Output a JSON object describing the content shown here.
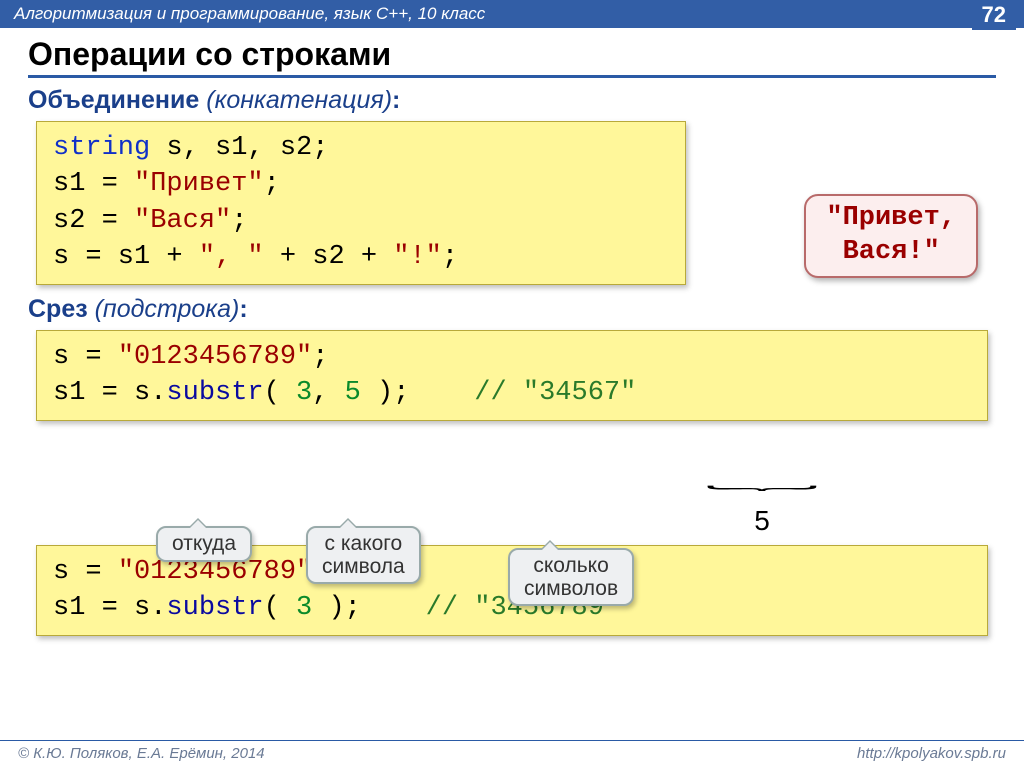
{
  "header": {
    "course": "Алгоритмизация и программирование, язык C++, 10 класс",
    "page": "72"
  },
  "title": "Операции со строками",
  "sec1": {
    "kw": "Объединение",
    "paren": "(конкатенация)",
    "colon": ":",
    "code": {
      "l1_kw": "string",
      "l1_rest": " s, s1, s2;",
      "l2a": "s1 = ",
      "l2s": "\"Привет\"",
      "l2b": ";",
      "l3a": "s2 = ",
      "l3s": "\"Вася\"",
      "l3b": ";",
      "l4a": "s = s1 + ",
      "l4s1": "\", \"",
      "l4b": " + s2 + ",
      "l4s2": "\"!\"",
      "l4c": ";"
    },
    "result": "\"Привет,\nВася!\""
  },
  "sec2": {
    "kw": "Срез",
    "paren": "(подстрока)",
    "colon": ":",
    "code1": {
      "l1a": "s = ",
      "l1s": "\"0123456789\"",
      "l1b": ";",
      "l2a": "s1 = s.",
      "l2f": "substr",
      "l2b": "( ",
      "l2n1": "3",
      "l2c": ", ",
      "l2n2": "5",
      "l2d": " );    ",
      "l2cmt": "// \"34567\""
    },
    "callouts": {
      "c1": "откуда",
      "c2": "с какого\nсимвола",
      "c3": "сколько\nсимволов"
    },
    "brace_num": "5",
    "code2": {
      "l1a": "s = ",
      "l1s": "\"0123456789\"",
      "l1b": ";",
      "l2a": "s1 = s.",
      "l2f": "substr",
      "l2b": "( ",
      "l2n1": "3",
      "l2c": " );    ",
      "l2cmt": "// \"3456789\""
    }
  },
  "footer": {
    "left": "© К.Ю. Поляков, Е.А. Ерёмин, 2014",
    "right": "http://kpolyakov.spb.ru"
  }
}
